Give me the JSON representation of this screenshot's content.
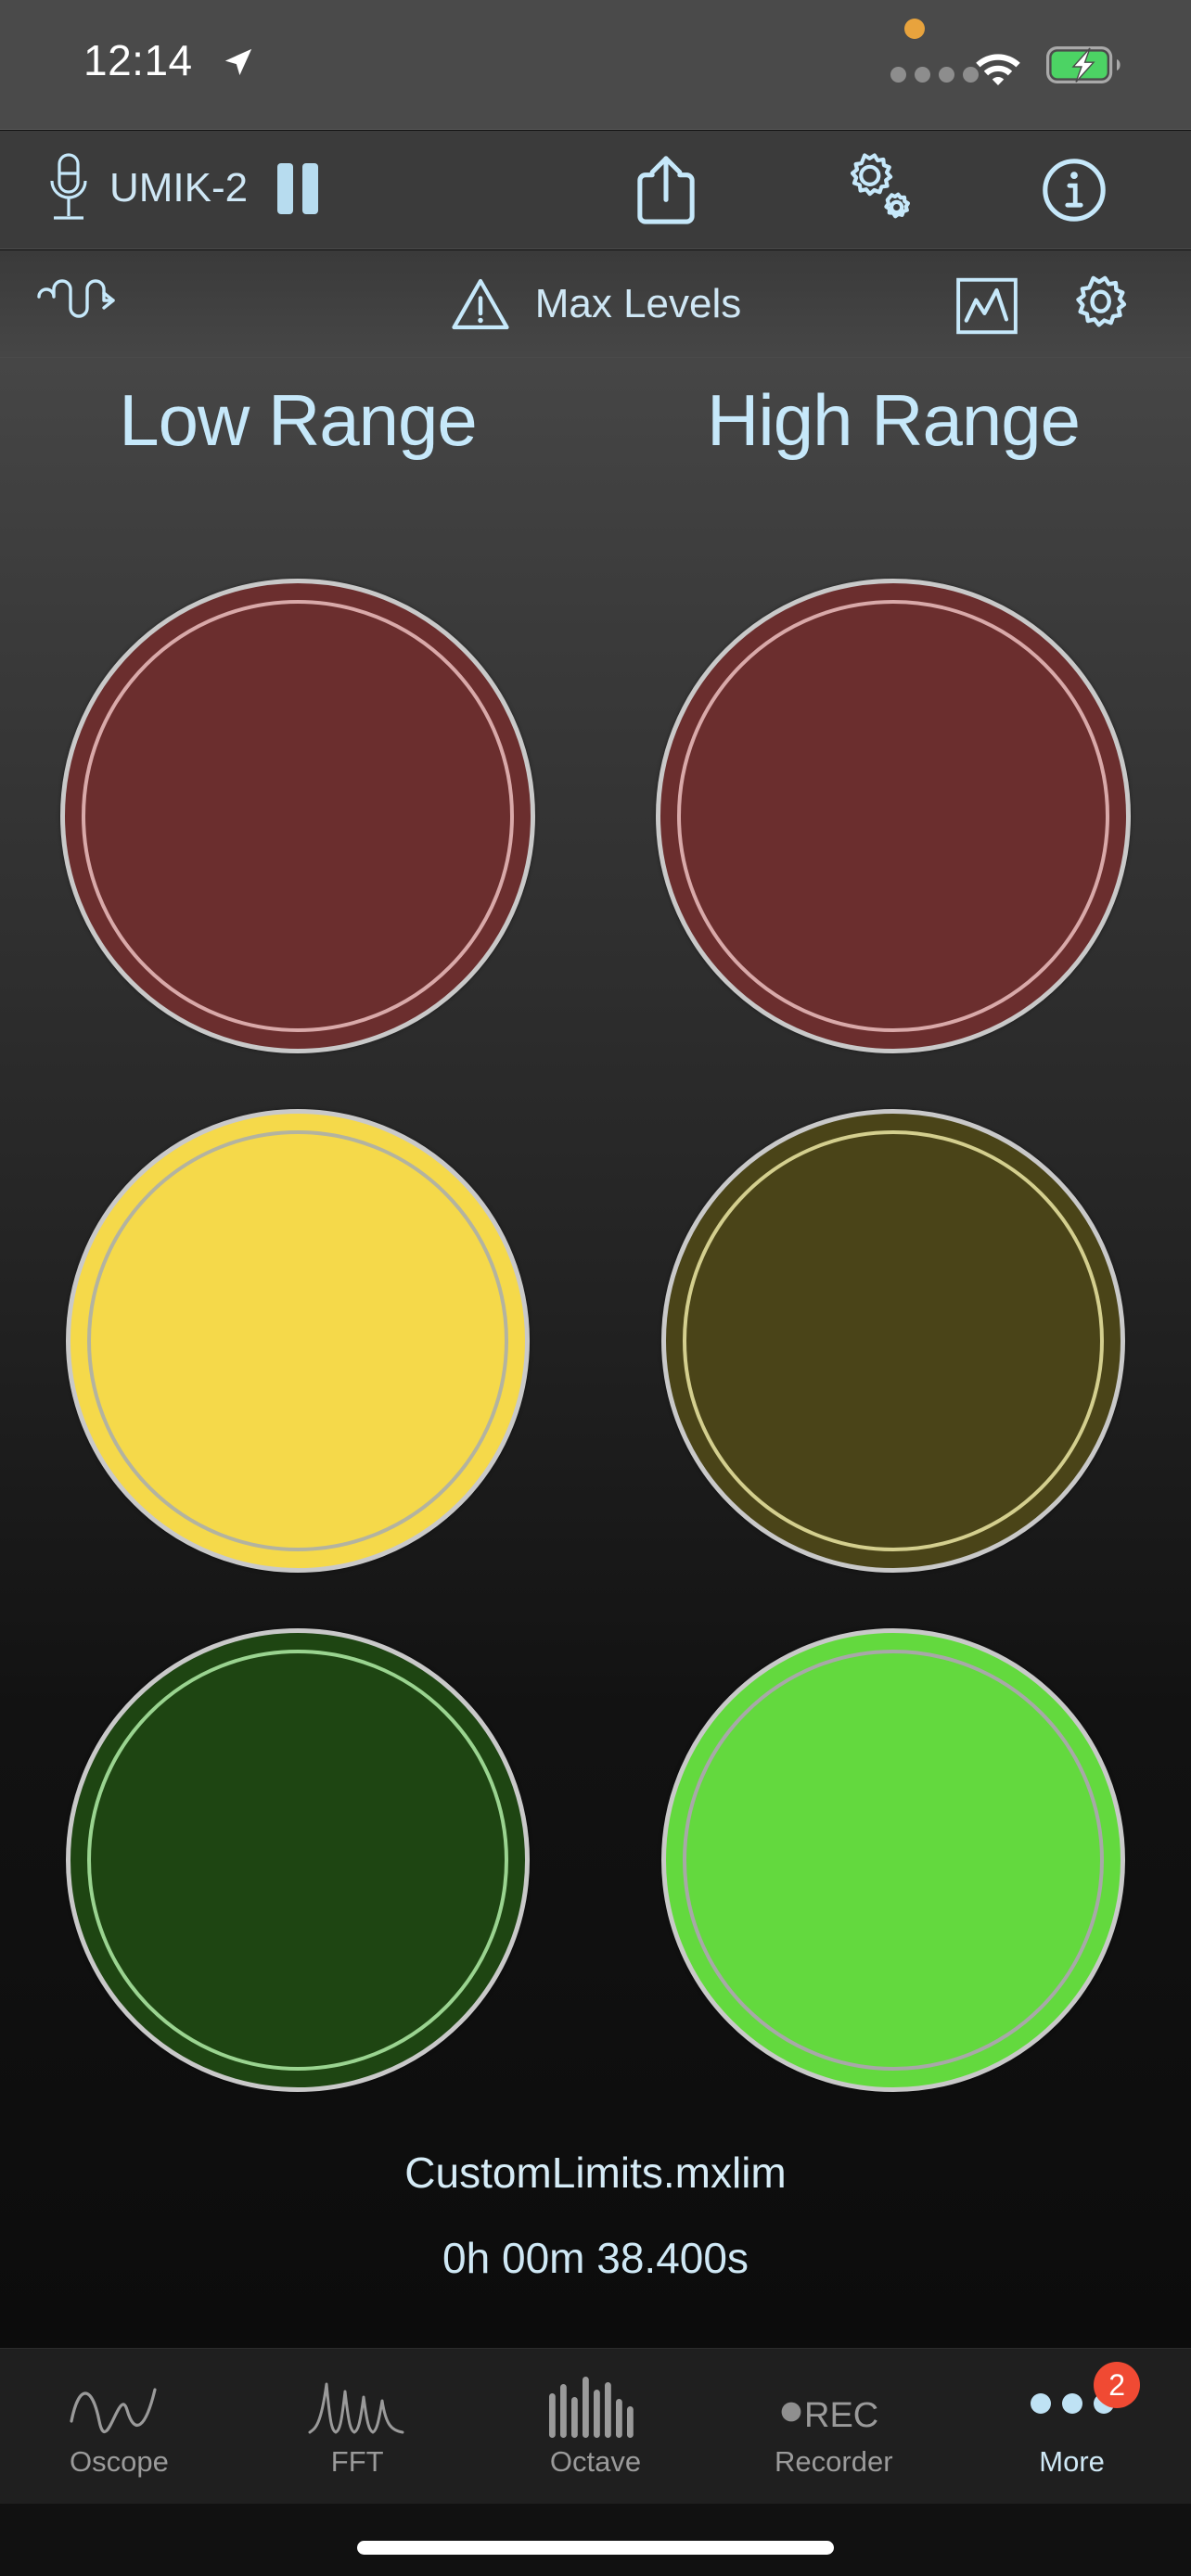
{
  "status_bar": {
    "time": "12:14",
    "location_icon": "location-arrow-icon",
    "mic_privacy_indicator": "orange-dot-icon",
    "cellular_icon": "cellular-dots-icon",
    "wifi_icon": "wifi-icon",
    "battery_icon": "battery-charging-icon",
    "battery_color": "#4cd364"
  },
  "toolbar": {
    "mic_icon": "microphone-icon",
    "device_name": "UMIK-2",
    "pause_button": "pause-icon",
    "share_button": "share-icon",
    "settings_button": "double-gears-icon",
    "info_button": "info-circle-icon",
    "accent_color": "#c6e8fa"
  },
  "subtoolbar": {
    "signal_generator_icon": "waveform-arrow-icon",
    "warning_icon": "warning-triangle-icon",
    "title": "Max Levels",
    "graph_button": "chart-in-box-icon",
    "settings_button": "gear-icon"
  },
  "main": {
    "columns": [
      "Low Range",
      "High Range"
    ],
    "lights": [
      {
        "row": "red",
        "low": {
          "state": "off",
          "color": "#6b2e2e",
          "ring": "#d9a9a9"
        },
        "high": {
          "state": "off",
          "color": "#6b2e2e",
          "ring": "#d9a9a9"
        }
      },
      {
        "row": "yellow",
        "low": {
          "state": "on",
          "color": "#f5d94a",
          "ring": "#b3b3a0"
        },
        "high": {
          "state": "off",
          "color": "#4a4418",
          "ring": "#d4cf8e"
        }
      },
      {
        "row": "green",
        "low": {
          "state": "off",
          "color": "#1e4512",
          "ring": "#9ad490"
        },
        "high": {
          "state": "on",
          "color": "#63d93e",
          "ring": "#a8a8a8"
        }
      }
    ],
    "outer_ring_color": "#c9c9c9",
    "file_name": "CustomLimits.mxlim",
    "elapsed_time": "0h 00m 38.400s"
  },
  "tab_bar": {
    "items": [
      {
        "label": "Oscope",
        "icon": "sine-wave-icon",
        "active": false
      },
      {
        "label": "FFT",
        "icon": "fft-peaks-icon",
        "active": false
      },
      {
        "label": "Octave",
        "icon": "octave-bars-icon",
        "active": false
      },
      {
        "label": "Recorder",
        "icon": "rec-dot-icon",
        "active": false
      },
      {
        "label": "More",
        "icon": "more-dots-icon",
        "active": true
      }
    ],
    "more_badge": "2",
    "badge_color": "#f04a33",
    "active_color": "#cfe8f5",
    "inactive_color": "#9a9a9a"
  }
}
